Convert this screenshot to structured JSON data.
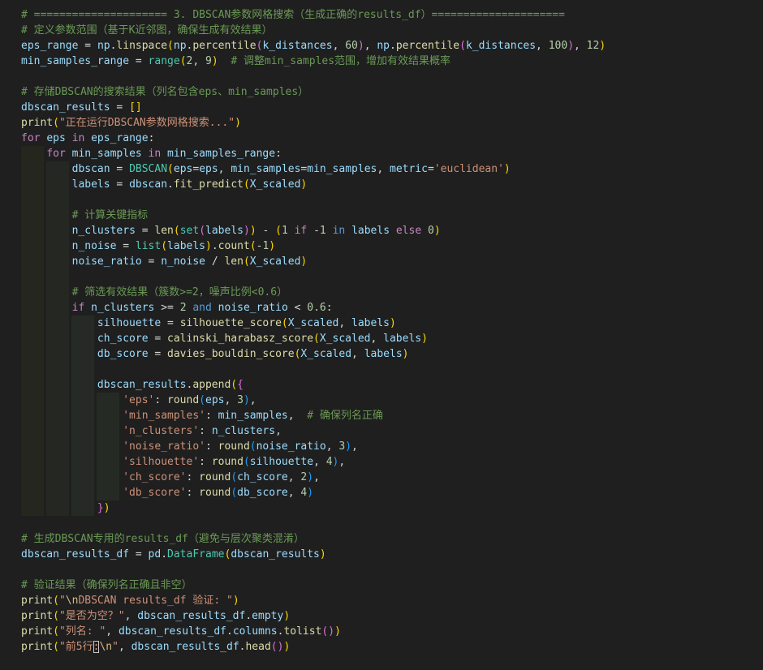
{
  "editor": {
    "theme_colors": {
      "background": "#1f1f1f",
      "comment": "#6a9955",
      "keyword": "#c586c0",
      "builtin_keyword": "#569cd6",
      "function": "#dcdcaa",
      "variable": "#9cdcfe",
      "class": "#4ec9b0",
      "string": "#ce9178",
      "number": "#b5cea8"
    },
    "lines": [
      [
        [
          "t-comment",
          "# ===================== 3. DBSCAN参数网格搜索（生成正确的results_df）====================="
        ]
      ],
      [
        [
          "t-comment",
          "# 定义参数范围（基于K近邻图，确保生成有效结果）"
        ]
      ],
      [
        [
          "t-var",
          "eps_range"
        ],
        [
          "t-op",
          " = "
        ],
        [
          "t-var",
          "np"
        ],
        [
          "t-op",
          "."
        ],
        [
          "t-func",
          "linspace"
        ],
        [
          "t-brace",
          "("
        ],
        [
          "t-var",
          "np"
        ],
        [
          "t-op",
          "."
        ],
        [
          "t-func",
          "percentile"
        ],
        [
          "t-paren2",
          "("
        ],
        [
          "t-var",
          "k_distances"
        ],
        [
          "t-op",
          ", "
        ],
        [
          "t-number",
          "60"
        ],
        [
          "t-paren2",
          ")"
        ],
        [
          "t-op",
          ", "
        ],
        [
          "t-var",
          "np"
        ],
        [
          "t-op",
          "."
        ],
        [
          "t-func",
          "percentile"
        ],
        [
          "t-paren2",
          "("
        ],
        [
          "t-var",
          "k_distances"
        ],
        [
          "t-op",
          ", "
        ],
        [
          "t-number",
          "100"
        ],
        [
          "t-paren2",
          ")"
        ],
        [
          "t-op",
          ", "
        ],
        [
          "t-number",
          "12"
        ],
        [
          "t-brace",
          ")"
        ]
      ],
      [
        [
          "t-var",
          "min_samples_range"
        ],
        [
          "t-op",
          " = "
        ],
        [
          "t-class",
          "range"
        ],
        [
          "t-brace",
          "("
        ],
        [
          "t-number",
          "2"
        ],
        [
          "t-op",
          ", "
        ],
        [
          "t-number",
          "9"
        ],
        [
          "t-brace",
          ")"
        ],
        [
          "t-op",
          "  "
        ],
        [
          "t-comment",
          "# 调整min_samples范围，增加有效结果概率"
        ]
      ],
      [],
      [
        [
          "t-comment",
          "# 存储DBSCAN的搜索结果（列名包含eps、min_samples）"
        ]
      ],
      [
        [
          "t-var",
          "dbscan_results"
        ],
        [
          "t-op",
          " = "
        ],
        [
          "t-brace",
          "[]"
        ]
      ],
      [
        [
          "t-func",
          "print"
        ],
        [
          "t-brace",
          "("
        ],
        [
          "t-string",
          "\"正在运行DBSCAN参数网格搜索...\""
        ],
        [
          "t-brace",
          ")"
        ]
      ],
      [
        [
          "t-keyword",
          "for"
        ],
        [
          "t-op",
          " "
        ],
        [
          "t-var",
          "eps"
        ],
        [
          "t-op",
          " "
        ],
        [
          "t-keyword",
          "in"
        ],
        [
          "t-op",
          " "
        ],
        [
          "t-var",
          "eps_range"
        ],
        [
          "t-op",
          ":"
        ]
      ],
      [
        [
          "t-op",
          "    "
        ],
        [
          "t-keyword",
          "for"
        ],
        [
          "t-op",
          " "
        ],
        [
          "t-var",
          "min_samples"
        ],
        [
          "t-op",
          " "
        ],
        [
          "t-keyword",
          "in"
        ],
        [
          "t-op",
          " "
        ],
        [
          "t-var",
          "min_samples_range"
        ],
        [
          "t-op",
          ":"
        ]
      ],
      [
        [
          "t-op",
          "        "
        ],
        [
          "t-var",
          "dbscan"
        ],
        [
          "t-op",
          " = "
        ],
        [
          "t-class",
          "DBSCAN"
        ],
        [
          "t-brace",
          "("
        ],
        [
          "t-var",
          "eps"
        ],
        [
          "t-op",
          "="
        ],
        [
          "t-var",
          "eps"
        ],
        [
          "t-op",
          ", "
        ],
        [
          "t-var",
          "min_samples"
        ],
        [
          "t-op",
          "="
        ],
        [
          "t-var",
          "min_samples"
        ],
        [
          "t-op",
          ", "
        ],
        [
          "t-var",
          "metric"
        ],
        [
          "t-op",
          "="
        ],
        [
          "t-string",
          "'euclidean'"
        ],
        [
          "t-brace",
          ")"
        ]
      ],
      [
        [
          "t-op",
          "        "
        ],
        [
          "t-var",
          "labels"
        ],
        [
          "t-op",
          " = "
        ],
        [
          "t-var",
          "dbscan"
        ],
        [
          "t-op",
          "."
        ],
        [
          "t-func",
          "fit_predict"
        ],
        [
          "t-brace",
          "("
        ],
        [
          "t-var",
          "X_scaled"
        ],
        [
          "t-brace",
          ")"
        ]
      ],
      [],
      [
        [
          "t-op",
          "        "
        ],
        [
          "t-comment",
          "# 计算关键指标"
        ]
      ],
      [
        [
          "t-op",
          "        "
        ],
        [
          "t-var",
          "n_clusters"
        ],
        [
          "t-op",
          " = "
        ],
        [
          "t-func",
          "len"
        ],
        [
          "t-brace",
          "("
        ],
        [
          "t-class",
          "set"
        ],
        [
          "t-paren2",
          "("
        ],
        [
          "t-var",
          "labels"
        ],
        [
          "t-paren2",
          ")"
        ],
        [
          "t-brace",
          ")"
        ],
        [
          "t-op",
          " - "
        ],
        [
          "t-brace",
          "("
        ],
        [
          "t-number",
          "1"
        ],
        [
          "t-op",
          " "
        ],
        [
          "t-keyword",
          "if"
        ],
        [
          "t-op",
          " -"
        ],
        [
          "t-number",
          "1"
        ],
        [
          "t-op",
          " "
        ],
        [
          "t-kw-blue",
          "in"
        ],
        [
          "t-op",
          " "
        ],
        [
          "t-var",
          "labels"
        ],
        [
          "t-op",
          " "
        ],
        [
          "t-keyword",
          "else"
        ],
        [
          "t-op",
          " "
        ],
        [
          "t-number",
          "0"
        ],
        [
          "t-brace",
          ")"
        ]
      ],
      [
        [
          "t-op",
          "        "
        ],
        [
          "t-var",
          "n_noise"
        ],
        [
          "t-op",
          " = "
        ],
        [
          "t-class",
          "list"
        ],
        [
          "t-brace",
          "("
        ],
        [
          "t-var",
          "labels"
        ],
        [
          "t-brace",
          ")"
        ],
        [
          "t-op",
          "."
        ],
        [
          "t-func",
          "count"
        ],
        [
          "t-brace",
          "("
        ],
        [
          "t-op",
          "-"
        ],
        [
          "t-number",
          "1"
        ],
        [
          "t-brace",
          ")"
        ]
      ],
      [
        [
          "t-op",
          "        "
        ],
        [
          "t-var",
          "noise_ratio"
        ],
        [
          "t-op",
          " = "
        ],
        [
          "t-var",
          "n_noise"
        ],
        [
          "t-op",
          " / "
        ],
        [
          "t-func",
          "len"
        ],
        [
          "t-brace",
          "("
        ],
        [
          "t-var",
          "X_scaled"
        ],
        [
          "t-brace",
          ")"
        ]
      ],
      [],
      [
        [
          "t-op",
          "        "
        ],
        [
          "t-comment",
          "# 筛选有效结果（簇数>=2，噪声比例<0.6）"
        ]
      ],
      [
        [
          "t-op",
          "        "
        ],
        [
          "t-keyword",
          "if"
        ],
        [
          "t-op",
          " "
        ],
        [
          "t-var",
          "n_clusters"
        ],
        [
          "t-op",
          " >= "
        ],
        [
          "t-number",
          "2"
        ],
        [
          "t-op",
          " "
        ],
        [
          "t-kw-blue",
          "and"
        ],
        [
          "t-op",
          " "
        ],
        [
          "t-var",
          "noise_ratio"
        ],
        [
          "t-op",
          " < "
        ],
        [
          "t-number",
          "0.6"
        ],
        [
          "t-op",
          ":"
        ]
      ],
      [
        [
          "t-op",
          "            "
        ],
        [
          "t-var",
          "silhouette"
        ],
        [
          "t-op",
          " = "
        ],
        [
          "t-func",
          "silhouette_score"
        ],
        [
          "t-brace",
          "("
        ],
        [
          "t-var",
          "X_scaled"
        ],
        [
          "t-op",
          ", "
        ],
        [
          "t-var",
          "labels"
        ],
        [
          "t-brace",
          ")"
        ]
      ],
      [
        [
          "t-op",
          "            "
        ],
        [
          "t-var",
          "ch_score"
        ],
        [
          "t-op",
          " = "
        ],
        [
          "t-func",
          "calinski_harabasz_score"
        ],
        [
          "t-brace",
          "("
        ],
        [
          "t-var",
          "X_scaled"
        ],
        [
          "t-op",
          ", "
        ],
        [
          "t-var",
          "labels"
        ],
        [
          "t-brace",
          ")"
        ]
      ],
      [
        [
          "t-op",
          "            "
        ],
        [
          "t-var",
          "db_score"
        ],
        [
          "t-op",
          " = "
        ],
        [
          "t-func",
          "davies_bouldin_score"
        ],
        [
          "t-brace",
          "("
        ],
        [
          "t-var",
          "X_scaled"
        ],
        [
          "t-op",
          ", "
        ],
        [
          "t-var",
          "labels"
        ],
        [
          "t-brace",
          ")"
        ]
      ],
      [],
      [
        [
          "t-op",
          "            "
        ],
        [
          "t-var",
          "dbscan_results"
        ],
        [
          "t-op",
          "."
        ],
        [
          "t-func",
          "append"
        ],
        [
          "t-brace",
          "("
        ],
        [
          "t-paren2",
          "{"
        ]
      ],
      [
        [
          "t-op",
          "                "
        ],
        [
          "t-string",
          "'eps'"
        ],
        [
          "t-op",
          ": "
        ],
        [
          "t-func",
          "round"
        ],
        [
          "t-paren3",
          "("
        ],
        [
          "t-var",
          "eps"
        ],
        [
          "t-op",
          ", "
        ],
        [
          "t-number",
          "3"
        ],
        [
          "t-paren3",
          ")"
        ],
        [
          "t-op",
          ","
        ]
      ],
      [
        [
          "t-op",
          "                "
        ],
        [
          "t-string",
          "'min_samples'"
        ],
        [
          "t-op",
          ": "
        ],
        [
          "t-var",
          "min_samples"
        ],
        [
          "t-op",
          ",  "
        ],
        [
          "t-comment",
          "# 确保列名正确"
        ]
      ],
      [
        [
          "t-op",
          "                "
        ],
        [
          "t-string",
          "'n_clusters'"
        ],
        [
          "t-op",
          ": "
        ],
        [
          "t-var",
          "n_clusters"
        ],
        [
          "t-op",
          ","
        ]
      ],
      [
        [
          "t-op",
          "                "
        ],
        [
          "t-string",
          "'noise_ratio'"
        ],
        [
          "t-op",
          ": "
        ],
        [
          "t-func",
          "round"
        ],
        [
          "t-paren3",
          "("
        ],
        [
          "t-var",
          "noise_ratio"
        ],
        [
          "t-op",
          ", "
        ],
        [
          "t-number",
          "3"
        ],
        [
          "t-paren3",
          ")"
        ],
        [
          "t-op",
          ","
        ]
      ],
      [
        [
          "t-op",
          "                "
        ],
        [
          "t-string",
          "'silhouette'"
        ],
        [
          "t-op",
          ": "
        ],
        [
          "t-func",
          "round"
        ],
        [
          "t-paren3",
          "("
        ],
        [
          "t-var",
          "silhouette"
        ],
        [
          "t-op",
          ", "
        ],
        [
          "t-number",
          "4"
        ],
        [
          "t-paren3",
          ")"
        ],
        [
          "t-op",
          ","
        ]
      ],
      [
        [
          "t-op",
          "                "
        ],
        [
          "t-string",
          "'ch_score'"
        ],
        [
          "t-op",
          ": "
        ],
        [
          "t-func",
          "round"
        ],
        [
          "t-paren3",
          "("
        ],
        [
          "t-var",
          "ch_score"
        ],
        [
          "t-op",
          ", "
        ],
        [
          "t-number",
          "2"
        ],
        [
          "t-paren3",
          ")"
        ],
        [
          "t-op",
          ","
        ]
      ],
      [
        [
          "t-op",
          "                "
        ],
        [
          "t-string",
          "'db_score'"
        ],
        [
          "t-op",
          ": "
        ],
        [
          "t-func",
          "round"
        ],
        [
          "t-paren3",
          "("
        ],
        [
          "t-var",
          "db_score"
        ],
        [
          "t-op",
          ", "
        ],
        [
          "t-number",
          "4"
        ],
        [
          "t-paren3",
          ")"
        ]
      ],
      [
        [
          "t-op",
          "            "
        ],
        [
          "t-paren2",
          "}"
        ],
        [
          "t-brace",
          ")"
        ]
      ],
      [],
      [
        [
          "t-comment",
          "# 生成DBSCAN专用的results_df（避免与层次聚类混淆）"
        ]
      ],
      [
        [
          "t-var",
          "dbscan_results_df"
        ],
        [
          "t-op",
          " = "
        ],
        [
          "t-var",
          "pd"
        ],
        [
          "t-op",
          "."
        ],
        [
          "t-class",
          "DataFrame"
        ],
        [
          "t-brace",
          "("
        ],
        [
          "t-var",
          "dbscan_results"
        ],
        [
          "t-brace",
          ")"
        ]
      ],
      [],
      [
        [
          "t-comment",
          "# 验证结果（确保列名正确且非空）"
        ]
      ],
      [
        [
          "t-func",
          "print"
        ],
        [
          "t-brace",
          "("
        ],
        [
          "t-string",
          "\""
        ],
        [
          "t-escape",
          "\\n"
        ],
        [
          "t-string",
          "DBSCAN results_df 验证: \""
        ],
        [
          "t-brace",
          ")"
        ]
      ],
      [
        [
          "t-func",
          "print"
        ],
        [
          "t-brace",
          "("
        ],
        [
          "t-string",
          "\"是否为空？\""
        ],
        [
          "t-op",
          ", "
        ],
        [
          "t-var",
          "dbscan_results_df"
        ],
        [
          "t-op",
          "."
        ],
        [
          "t-var",
          "empty"
        ],
        [
          "t-brace",
          ")"
        ]
      ],
      [
        [
          "t-func",
          "print"
        ],
        [
          "t-brace",
          "("
        ],
        [
          "t-string",
          "\"列名: \""
        ],
        [
          "t-op",
          ", "
        ],
        [
          "t-var",
          "dbscan_results_df"
        ],
        [
          "t-op",
          "."
        ],
        [
          "t-var",
          "columns"
        ],
        [
          "t-op",
          "."
        ],
        [
          "t-func",
          "tolist"
        ],
        [
          "t-paren2",
          "()"
        ],
        [
          "t-brace",
          ")"
        ]
      ],
      [
        [
          "t-func",
          "print"
        ],
        [
          "t-brace",
          "("
        ],
        [
          "t-string",
          "\"前5行"
        ],
        [
          "t-string cursor-box",
          ":"
        ],
        [
          "t-escape",
          "\\n"
        ],
        [
          "t-string",
          "\""
        ],
        [
          "t-op",
          ", "
        ],
        [
          "t-var",
          "dbscan_results_df"
        ],
        [
          "t-op",
          "."
        ],
        [
          "t-func",
          "head"
        ],
        [
          "t-paren2",
          "()"
        ],
        [
          "t-brace",
          ")"
        ]
      ]
    ]
  }
}
